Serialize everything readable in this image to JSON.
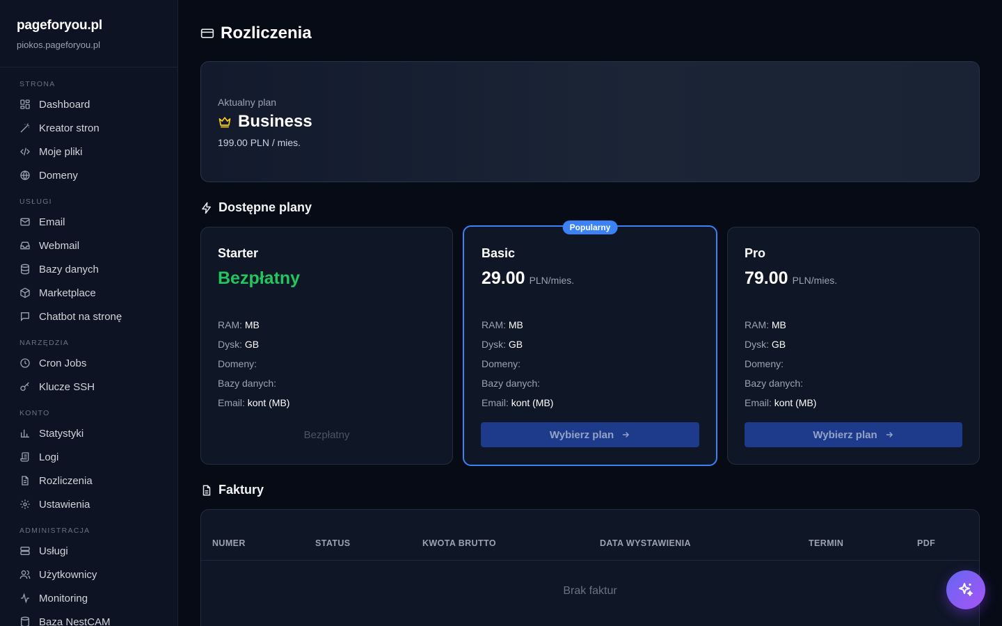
{
  "brand": {
    "title": "pageforyou.pl",
    "subtitle": "piokos.pageforyou.pl"
  },
  "sidebar": {
    "sections": [
      {
        "label": "STRONA",
        "items": [
          {
            "label": "Dashboard",
            "icon": "dashboard-icon"
          },
          {
            "label": "Kreator stron",
            "icon": "wand-icon"
          },
          {
            "label": "Moje pliki",
            "icon": "code-icon"
          },
          {
            "label": "Domeny",
            "icon": "globe-icon"
          }
        ]
      },
      {
        "label": "USŁUGI",
        "items": [
          {
            "label": "Email",
            "icon": "mail-icon"
          },
          {
            "label": "Webmail",
            "icon": "inbox-icon"
          },
          {
            "label": "Bazy danych",
            "icon": "database-icon"
          },
          {
            "label": "Marketplace",
            "icon": "package-icon"
          },
          {
            "label": "Chatbot na stronę",
            "icon": "chat-icon"
          }
        ]
      },
      {
        "label": "NARZĘDZIA",
        "items": [
          {
            "label": "Cron Jobs",
            "icon": "clock-icon"
          },
          {
            "label": "Klucze SSH",
            "icon": "key-icon"
          }
        ]
      },
      {
        "label": "KONTO",
        "items": [
          {
            "label": "Statystyki",
            "icon": "bar-chart-icon"
          },
          {
            "label": "Logi",
            "icon": "scroll-icon"
          },
          {
            "label": "Rozliczenia",
            "icon": "file-text-icon"
          },
          {
            "label": "Ustawienia",
            "icon": "gear-icon"
          }
        ]
      },
      {
        "label": "ADMINISTRACJA",
        "items": [
          {
            "label": "Usługi",
            "icon": "server-icon"
          },
          {
            "label": "Użytkownicy",
            "icon": "users-icon"
          },
          {
            "label": "Monitoring",
            "icon": "activity-icon"
          },
          {
            "label": "Baza NestCAM",
            "icon": "database-icon"
          }
        ]
      }
    ]
  },
  "page": {
    "title": "Rozliczenia",
    "icon": "credit-card-icon"
  },
  "current_plan": {
    "label": "Aktualny plan",
    "name": "Business",
    "price": "199.00 PLN / mies.",
    "icon": "crown-icon",
    "accent": "#facc15"
  },
  "plans_section": {
    "title": "Dostępne plany",
    "icon": "zap-icon"
  },
  "plans": [
    {
      "name": "Starter",
      "price": "Bezpłatny",
      "unit": "",
      "free": true,
      "popular": false,
      "ram_label": "RAM:",
      "ram": "MB",
      "disk_label": "Dysk:",
      "disk": "GB",
      "domains_label": "Domeny:",
      "db_label": "Bazy danych:",
      "email_label": "Email:",
      "email": "kont (MB)",
      "button": "Bezpłatny"
    },
    {
      "name": "Basic",
      "price": "29.00",
      "unit": "PLN/mies.",
      "free": false,
      "popular": true,
      "badge": "Popularny",
      "ram_label": "RAM:",
      "ram": "MB",
      "disk_label": "Dysk:",
      "disk": "GB",
      "domains_label": "Domeny:",
      "db_label": "Bazy danych:",
      "email_label": "Email:",
      "email": "kont (MB)",
      "button": "Wybierz plan"
    },
    {
      "name": "Pro",
      "price": "79.00",
      "unit": "PLN/mies.",
      "free": false,
      "popular": false,
      "ram_label": "RAM:",
      "ram": "MB",
      "disk_label": "Dysk:",
      "disk": "GB",
      "domains_label": "Domeny:",
      "db_label": "Bazy danych:",
      "email_label": "Email:",
      "email": "kont (MB)",
      "button": "Wybierz plan"
    }
  ],
  "invoices": {
    "title": "Faktury",
    "icon": "file-icon",
    "columns": [
      "NUMER",
      "STATUS",
      "KWOTA BRUTTO",
      "DATA WYSTAWIENIA",
      "TERMIN",
      "PDF"
    ],
    "empty": "Brak faktur"
  },
  "fab": {
    "icon": "sparkles-icon"
  },
  "colors": {
    "accent": "#3b82f6",
    "free": "#22c55e",
    "fab_from": "#6366f1",
    "fab_to": "#a855f7"
  }
}
